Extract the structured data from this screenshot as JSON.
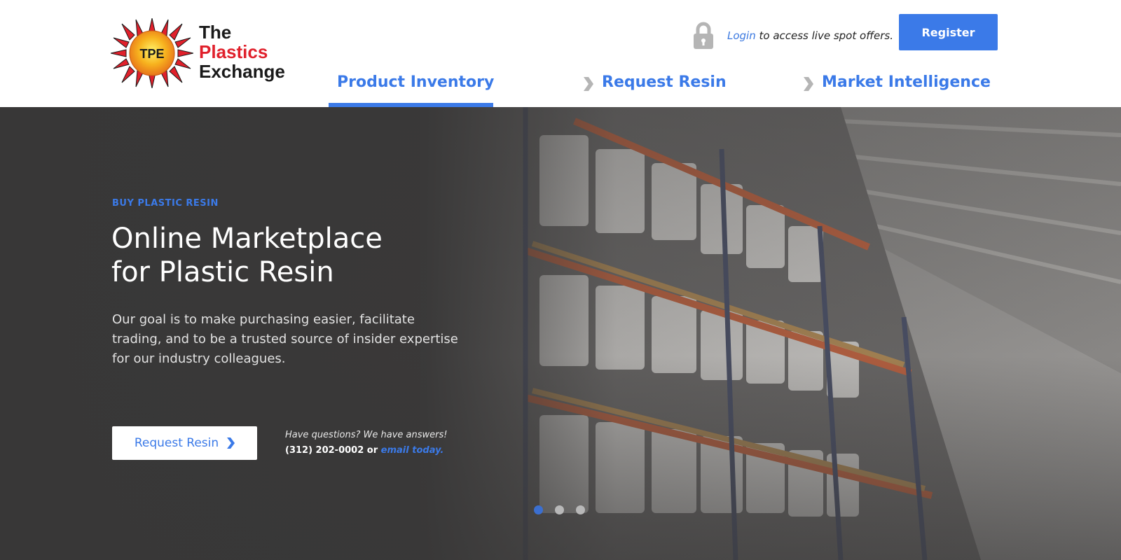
{
  "logo": {
    "badge_text": "TPE",
    "line1": "The",
    "line2": "Plastics",
    "line3": "Exchange"
  },
  "header": {
    "login_link": "Login",
    "login_suffix": " to access live spot offers.",
    "register_label": "Register"
  },
  "nav": {
    "items": [
      {
        "label": "Product Inventory",
        "active": true
      },
      {
        "label": "Request Resin",
        "active": false
      },
      {
        "label": "Market Intelligence",
        "active": false
      }
    ]
  },
  "hero": {
    "eyebrow": "BUY PLASTIC RESIN",
    "title_line1": "Online Marketplace",
    "title_line2": "for Plastic Resin",
    "description": "Our goal is to make purchasing easier, facilitate trading, and to be a trusted source of insider expertise for our industry colleagues.",
    "cta_label": "Request Resin",
    "contact_question": "Have questions? We have answers!",
    "contact_phone": "(312) 202-0002",
    "contact_or": " or ",
    "contact_email_link": "email today."
  },
  "carousel": {
    "slide_count": 3,
    "active_index": 0
  },
  "colors": {
    "accent": "#3b7ae8",
    "logo_red": "#e0202b",
    "hero_bg": "#3b3a3a"
  }
}
